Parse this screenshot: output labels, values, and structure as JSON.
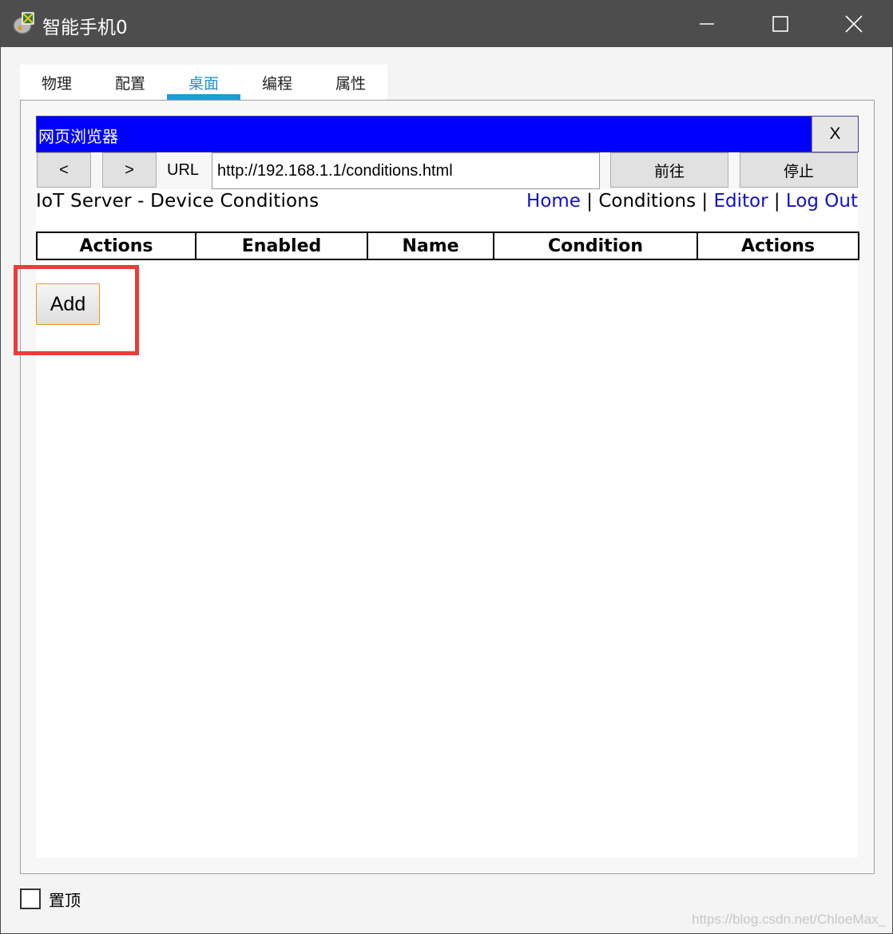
{
  "window": {
    "title": "智能手机0",
    "app_icon": "packet-tracer-device-icon",
    "controls": [
      "minimize-icon",
      "maximize-icon",
      "close-icon"
    ]
  },
  "tabs": [
    {
      "label": "物理",
      "active": false
    },
    {
      "label": "配置",
      "active": false
    },
    {
      "label": "桌面",
      "active": true
    },
    {
      "label": "编程",
      "active": false
    },
    {
      "label": "属性",
      "active": false
    }
  ],
  "browser": {
    "title": "网页浏览器",
    "close_label": "X",
    "back_label": "<",
    "forward_label": ">",
    "url_label": "URL",
    "url_value": "http://192.168.1.1/conditions.html",
    "go_label": "前往",
    "stop_label": "停止"
  },
  "page": {
    "heading": "IoT Server - Device Conditions",
    "nav": {
      "home": "Home",
      "sep1": " | ",
      "conditions": "Conditions",
      "sep2": " | ",
      "editor": "Editor",
      "sep3": " | ",
      "logout": "Log Out"
    },
    "table_headers": [
      "Actions",
      "Enabled",
      "Name",
      "Condition",
      "Actions"
    ],
    "add_label": "Add"
  },
  "footer": {
    "pin_label": "置顶",
    "pin_checked": false,
    "watermark": "https://blog.csdn.net/ChloeMax_"
  },
  "colors": {
    "titlebar": "#4d4d4d",
    "browser_bar": "#0000ff",
    "active_tab": "#1b93d1",
    "link": "#1010c8",
    "highlight": "#ee3a3a",
    "add_border": "#e49b1a"
  }
}
